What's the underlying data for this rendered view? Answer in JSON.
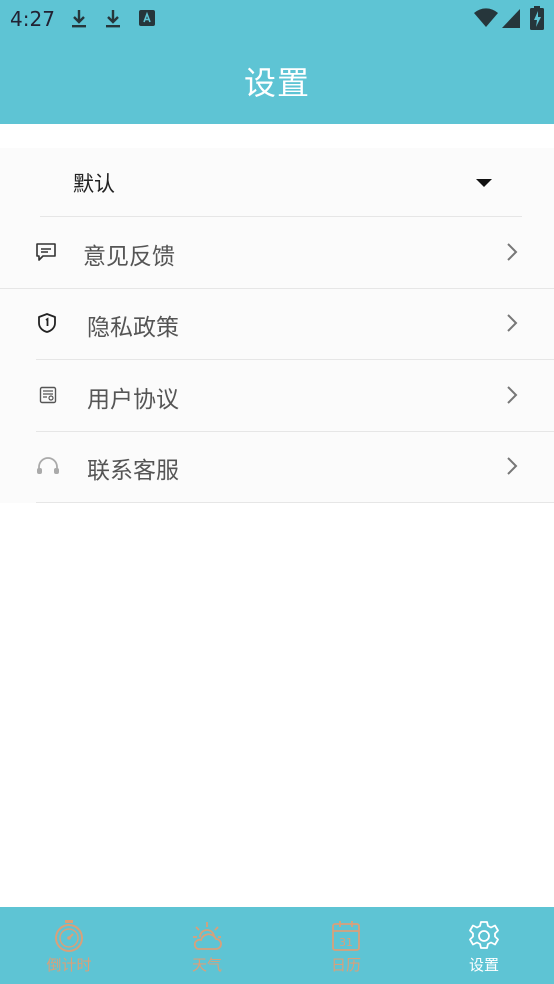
{
  "status_bar": {
    "time": "4:27",
    "icons": [
      "download-icon",
      "download-icon",
      "text-a-icon",
      "wifi-icon",
      "signal-icon",
      "battery-charging-icon"
    ]
  },
  "app_bar": {
    "title": "设置"
  },
  "settings": {
    "selector": {
      "value": "默认",
      "icon": "dropdown-caret-icon"
    },
    "items": [
      {
        "label": "意见反馈",
        "icon": "feedback-icon"
      },
      {
        "label": "隐私政策",
        "icon": "shield-icon"
      },
      {
        "label": "用户协议",
        "icon": "agreement-icon"
      },
      {
        "label": "联系客服",
        "icon": "headset-icon"
      }
    ]
  },
  "bottom_nav": {
    "items": [
      {
        "label": "倒计时",
        "icon": "stopwatch-icon",
        "active": false
      },
      {
        "label": "天气",
        "icon": "weather-icon",
        "active": false
      },
      {
        "label": "日历",
        "icon": "calendar-icon",
        "calendar_day": "31",
        "active": false
      },
      {
        "label": "设置",
        "icon": "gear-icon",
        "active": true
      }
    ]
  },
  "colors": {
    "primary": "#5ec4d4",
    "inactive_nav": "#d9a07a",
    "active_nav": "#ffffff"
  }
}
